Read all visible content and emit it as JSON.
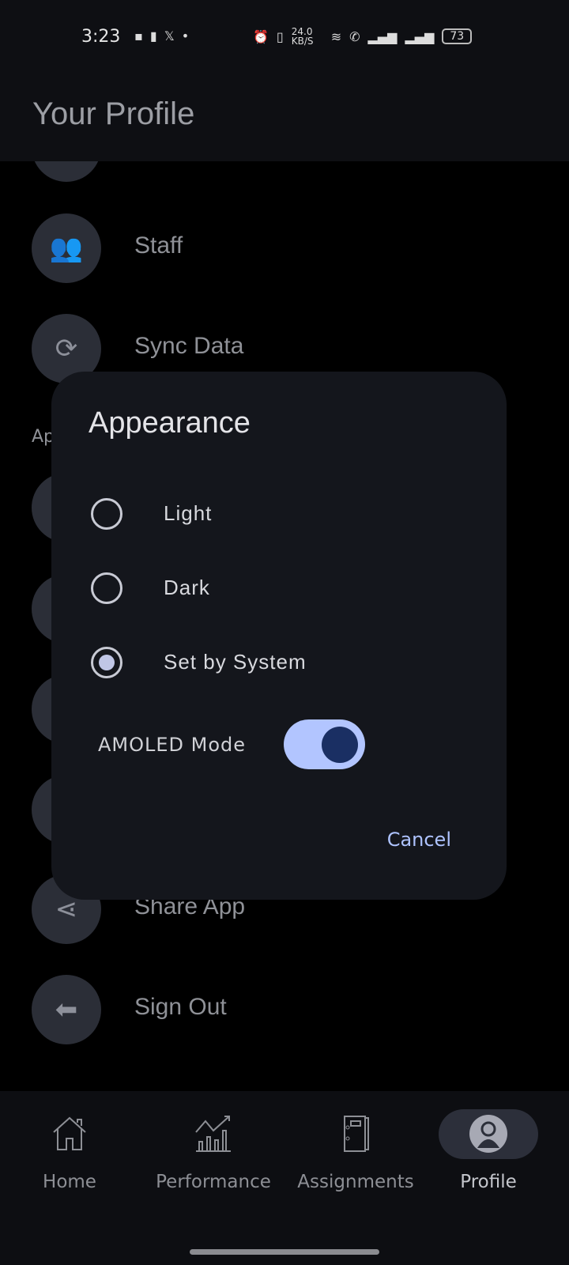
{
  "status_bar": {
    "time": "3:23",
    "net_speed": "24.0 KB/S",
    "battery": "73"
  },
  "header": {
    "title": "Your Profile"
  },
  "list": {
    "items": [
      {
        "label": "",
        "icon": "building-icon"
      },
      {
        "label": "Staff",
        "icon": "users-icon"
      },
      {
        "label": "Sync Data",
        "icon": "sync-icon"
      },
      {
        "label": "Share App",
        "icon": "share-icon"
      },
      {
        "label": "Sign Out",
        "icon": "sign-out-icon"
      }
    ],
    "section_partial": "Ap"
  },
  "dialog": {
    "title": "Appearance",
    "options": [
      {
        "label": "Light",
        "selected": false
      },
      {
        "label": "Dark",
        "selected": false
      },
      {
        "label": "Set by System",
        "selected": true
      }
    ],
    "amoled_label": "AMOLED Mode",
    "amoled_on": true,
    "cancel": "Cancel"
  },
  "nav": {
    "tabs": [
      {
        "label": "Home"
      },
      {
        "label": "Performance"
      },
      {
        "label": "Assignments"
      },
      {
        "label": "Profile",
        "active": true
      }
    ]
  },
  "colors": {
    "accent": "#b2c5ff",
    "dialog_bg": "#14161c",
    "knob": "#1a2f63"
  }
}
